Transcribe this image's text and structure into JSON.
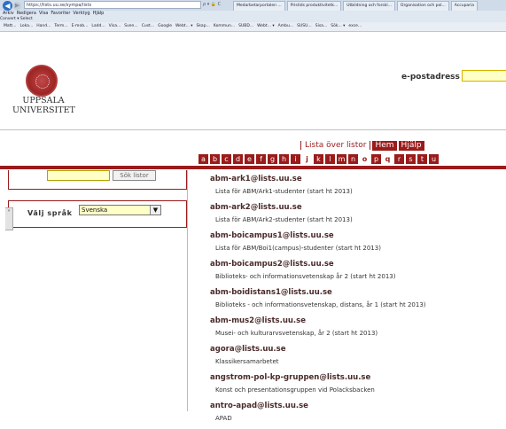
{
  "browser": {
    "back_icon": "back-arrow-icon",
    "forward_icon": "forward-arrow-icon",
    "address": "https://lists.uu.se/sympa/lists",
    "address_tools": "ρ ▾ 🔒 C",
    "tabs": [
      "Medarbetarportalen ...",
      "Pristids produktivitetk...",
      "Utbildning och forskl...",
      "Organisation och pol...",
      "Accuparia"
    ],
    "menu": [
      "Arkiv",
      "Redigera",
      "Visa",
      "Favoriter",
      "Verktyg",
      "Hjälp"
    ],
    "commands": [
      "Convert ▾",
      "Select"
    ],
    "favorites": [
      "Matt...",
      "Loka...",
      "Hand...",
      "Term...",
      "E-mob...",
      "Ladd...",
      "Visa...",
      "Sven...",
      "Cust...",
      "Google",
      "Webt... ▾",
      "Skap...",
      "Kommun...",
      "SUBD...",
      "Webt... ▾",
      "Ambu...",
      "SUSU...",
      "Sisa...",
      "Sök... ▾",
      "exce..."
    ]
  },
  "header": {
    "logo_line1": "UPPSALA",
    "logo_line2": "UNIVERSITET",
    "email_label": "e-postadress",
    "email_value": ""
  },
  "nav": {
    "lista": "Lista över listor",
    "hem": "Hem",
    "hjalp": "Hjälp"
  },
  "alphabet": [
    {
      "l": "a",
      "plain": false
    },
    {
      "l": "b",
      "plain": false
    },
    {
      "l": "c",
      "plain": false
    },
    {
      "l": "d",
      "plain": false
    },
    {
      "l": "e",
      "plain": false
    },
    {
      "l": "f",
      "plain": false
    },
    {
      "l": "g",
      "plain": false
    },
    {
      "l": "h",
      "plain": false
    },
    {
      "l": "i",
      "plain": false
    },
    {
      "l": "j",
      "plain": true
    },
    {
      "l": "k",
      "plain": false
    },
    {
      "l": "l",
      "plain": false
    },
    {
      "l": "m",
      "plain": false
    },
    {
      "l": "n",
      "plain": false
    },
    {
      "l": "o",
      "plain": true
    },
    {
      "l": "p",
      "plain": false
    },
    {
      "l": "q",
      "plain": true
    },
    {
      "l": "r",
      "plain": false
    },
    {
      "l": "s",
      "plain": false
    },
    {
      "l": "t",
      "plain": false
    },
    {
      "l": "u",
      "plain": false
    }
  ],
  "search": {
    "value": "",
    "button": "Sök listor"
  },
  "language": {
    "label": "Välj språk",
    "selected": "Svenska"
  },
  "lists": [
    {
      "address": "abm-ark1@lists.uu.se",
      "desc": "Lista för ABM/Ark1-studenter (start ht 2013)"
    },
    {
      "address": "abm-ark2@lists.uu.se",
      "desc": "Lista för ABM/Ark2-studenter (start ht 2013)"
    },
    {
      "address": "abm-boicampus1@lists.uu.se",
      "desc": "Lista för ABM/Boi1(campus)-studenter (start ht 2013)"
    },
    {
      "address": "abm-boicampus2@lists.uu.se",
      "desc": "Biblioteks- och informationsvetenskap år 2 (start ht 2013)"
    },
    {
      "address": "abm-boidistans1@lists.uu.se",
      "desc": "Biblioteks - och informationsvetenskap, distans, år 1 (start ht 2013)"
    },
    {
      "address": "abm-mus2@lists.uu.se",
      "desc": "Musei- och kulturarvsvetenskap, år 2 (start ht 2013)"
    },
    {
      "address": "agora@lists.uu.se",
      "desc": "Klassikersamarbetet"
    },
    {
      "address": "angstrom-pol-kp-gruppen@lists.uu.se",
      "desc": "Konst och presentationsgruppen vid Polacksbacken"
    },
    {
      "address": "antro-apad@lists.uu.se",
      "desc": "APAD"
    }
  ],
  "colors": {
    "brand": "#9b1b1b",
    "input_bg": "#ffffc8"
  }
}
